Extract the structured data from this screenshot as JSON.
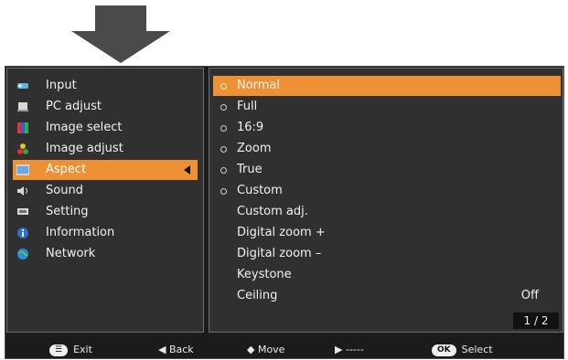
{
  "left_menu": {
    "items": [
      {
        "label": "Input",
        "icon": "input-icon"
      },
      {
        "label": "PC adjust",
        "icon": "pc-adjust-icon"
      },
      {
        "label": "Image select",
        "icon": "image-select-icon"
      },
      {
        "label": "Image adjust",
        "icon": "image-adjust-icon"
      },
      {
        "label": "Aspect",
        "icon": "aspect-icon",
        "selected": true
      },
      {
        "label": "Sound",
        "icon": "sound-icon"
      },
      {
        "label": "Setting",
        "icon": "setting-icon"
      },
      {
        "label": "Information",
        "icon": "information-icon"
      },
      {
        "label": "Network",
        "icon": "network-icon"
      }
    ]
  },
  "aspect_menu": {
    "items": [
      {
        "label": "Normal",
        "radio": true,
        "selected": true
      },
      {
        "label": "Full",
        "radio": true
      },
      {
        "label": "16:9",
        "radio": true
      },
      {
        "label": "Zoom",
        "radio": true
      },
      {
        "label": "True",
        "radio": true
      },
      {
        "label": "Custom",
        "radio": true
      },
      {
        "label": "Custom adj."
      },
      {
        "label": "Digital zoom +"
      },
      {
        "label": "Digital zoom –"
      },
      {
        "label": "Keystone"
      },
      {
        "label": "Ceiling",
        "value": "Off"
      }
    ],
    "page_indicator": "1 / 2"
  },
  "footer": {
    "exit_key": "☰",
    "exit": "Exit",
    "back": "◀ Back",
    "move": "◆ Move",
    "next": "▶ -----",
    "ok_key": "OK",
    "select": "Select"
  },
  "colors": {
    "highlight": "#ee9134",
    "panel": "#303030",
    "background": "#1b1b1b"
  }
}
